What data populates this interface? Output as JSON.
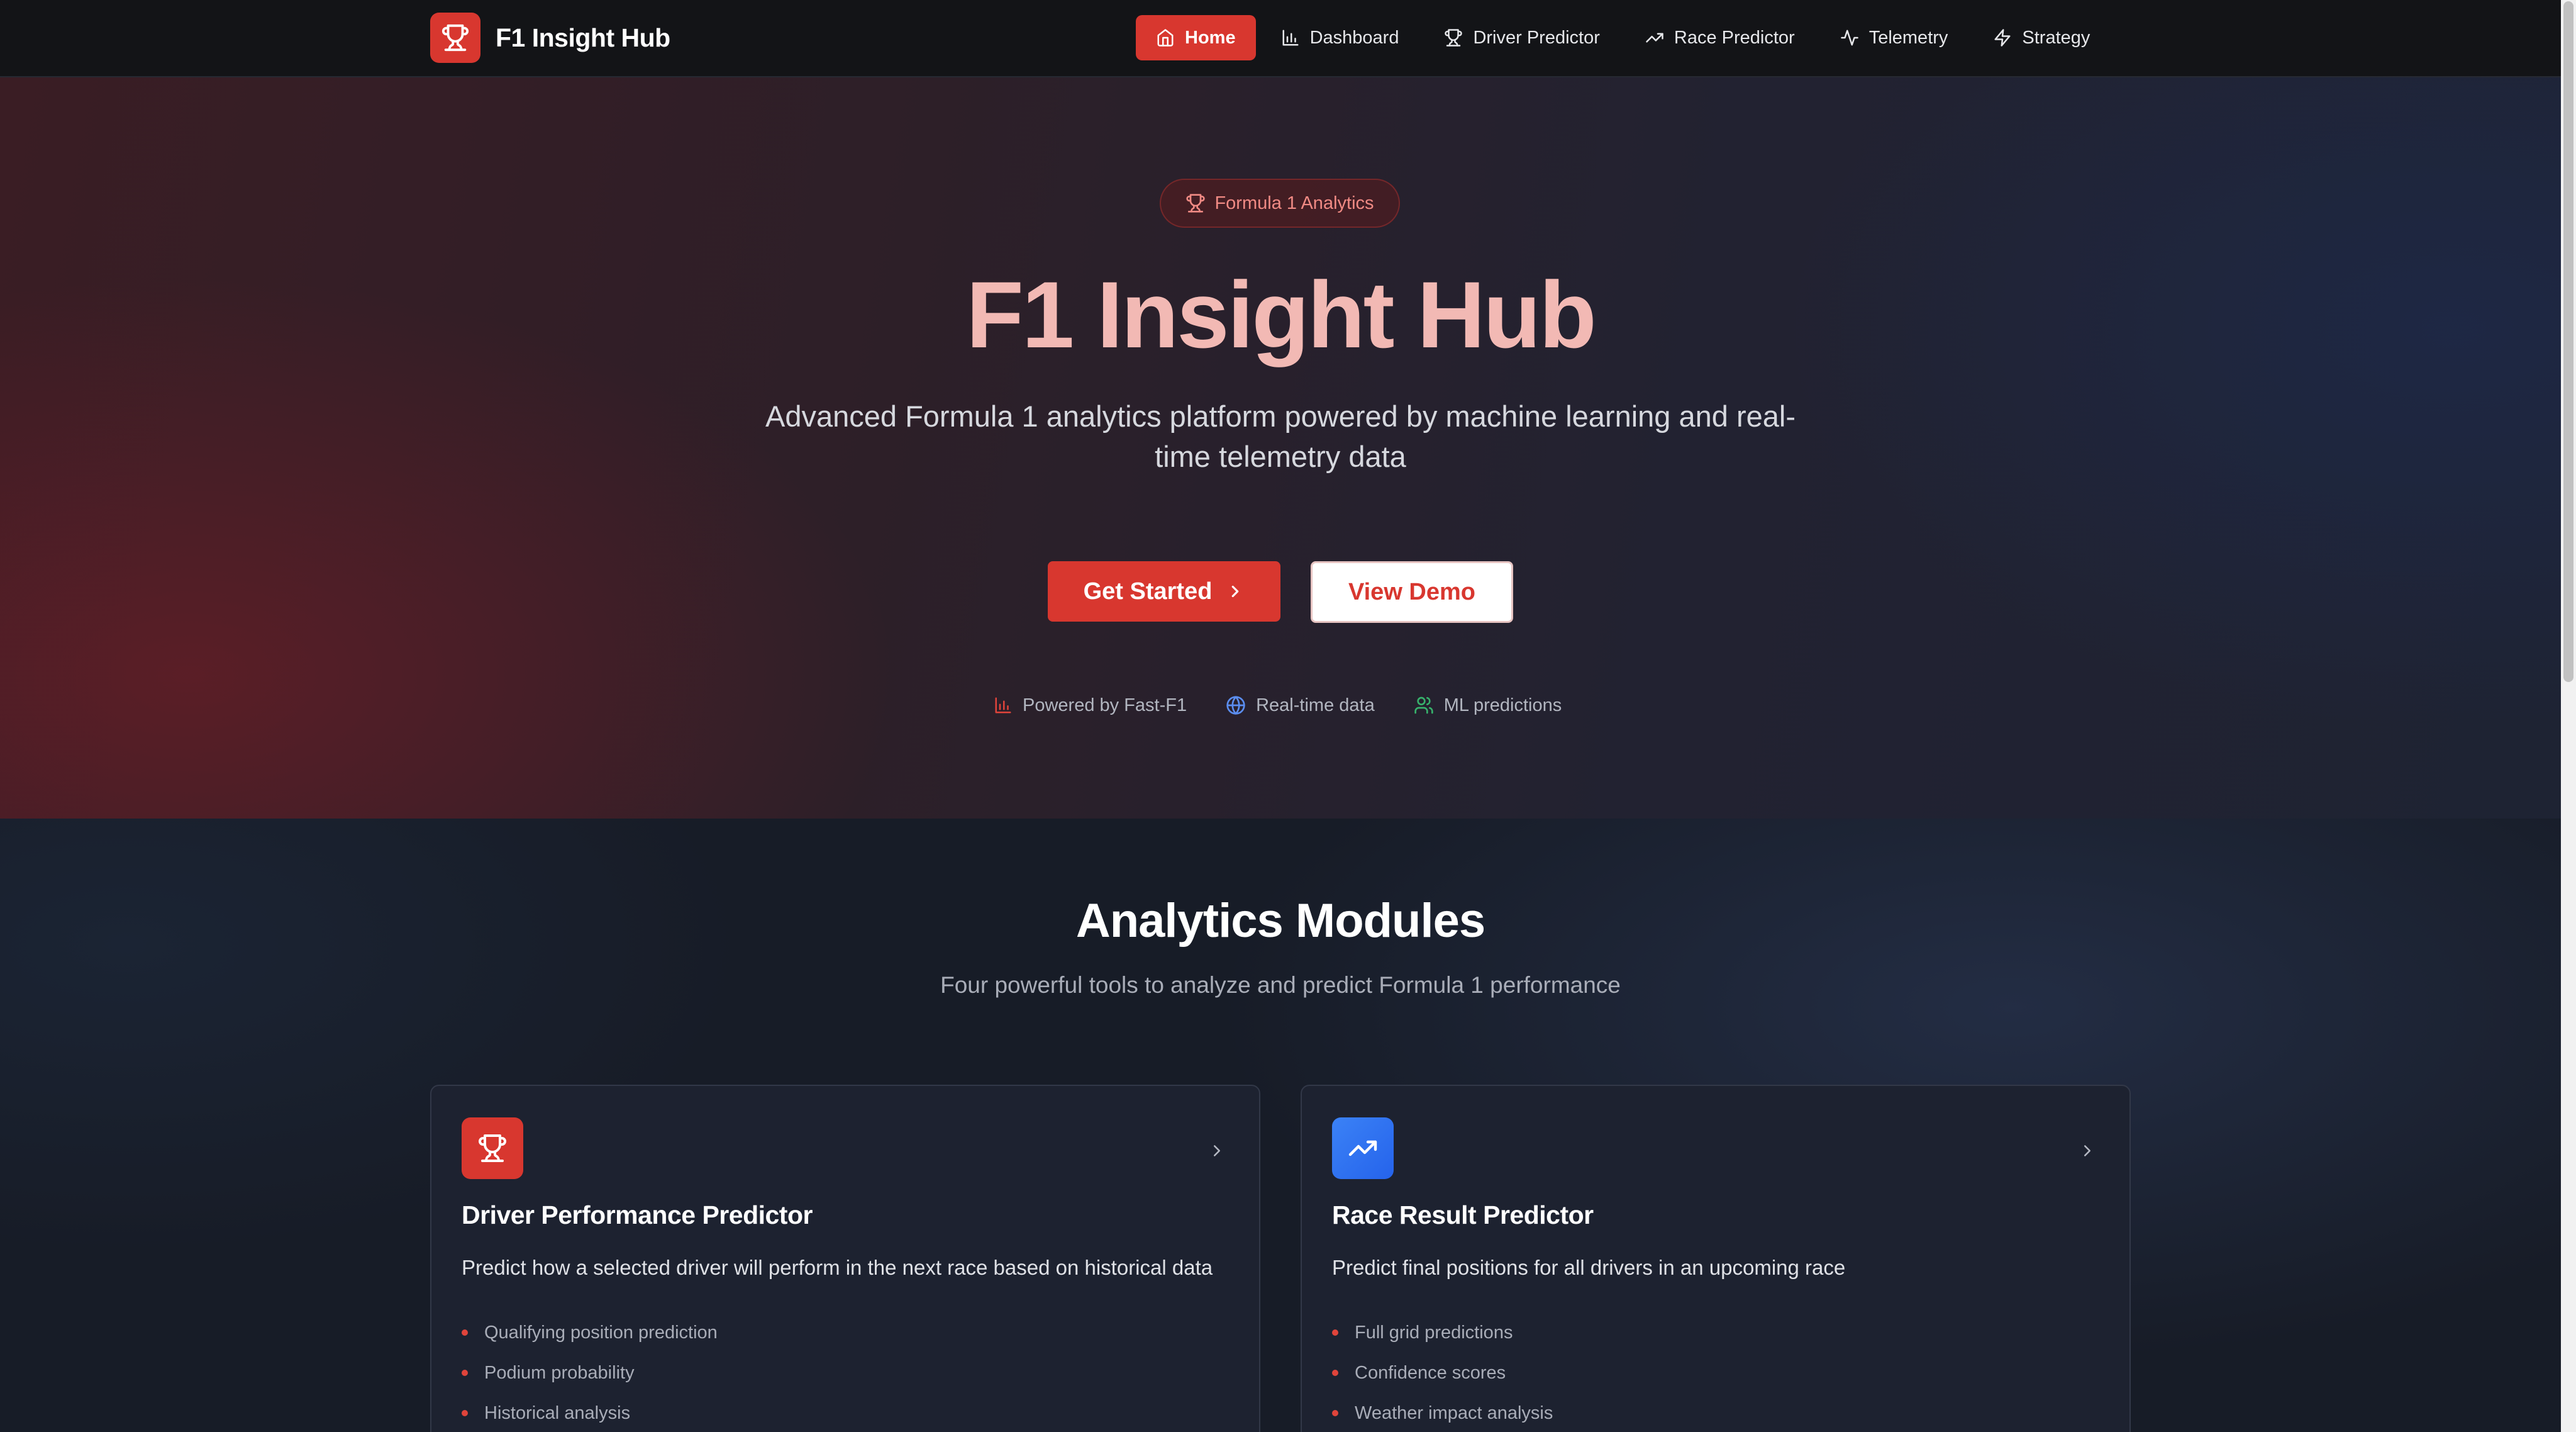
{
  "nav": {
    "brand": "F1 Insight Hub",
    "items": [
      {
        "label": "Home",
        "icon": "home-icon",
        "active": true
      },
      {
        "label": "Dashboard",
        "icon": "bar-chart-icon"
      },
      {
        "label": "Driver Predictor",
        "icon": "trophy-icon"
      },
      {
        "label": "Race Predictor",
        "icon": "trending-up-icon"
      },
      {
        "label": "Telemetry",
        "icon": "activity-icon"
      },
      {
        "label": "Strategy",
        "icon": "zap-icon"
      }
    ]
  },
  "hero": {
    "badge": "Formula 1 Analytics",
    "title": "F1 Insight Hub",
    "subtitle": "Advanced Formula 1 analytics platform powered by machine learning and real-time telemetry data",
    "primary_button": "Get Started",
    "secondary_button": "View Demo",
    "features": [
      {
        "label": "Powered by Fast-F1",
        "icon": "bar-chart-icon"
      },
      {
        "label": "Real-time data",
        "icon": "globe-icon"
      },
      {
        "label": "ML predictions",
        "icon": "users-icon"
      }
    ]
  },
  "modules": {
    "title": "Analytics Modules",
    "subtitle": "Four powerful tools to analyze and predict Formula 1 performance",
    "cards": [
      {
        "title": "Driver Performance Predictor",
        "description": "Predict how a selected driver will perform in the next race based on historical data",
        "icon": "trophy-icon",
        "points": [
          "Qualifying position prediction",
          "Podium probability",
          "Historical analysis"
        ]
      },
      {
        "title": "Race Result Predictor",
        "description": "Predict final positions for all drivers in an upcoming race",
        "icon": "trending-up-icon",
        "points": [
          "Full grid predictions",
          "Confidence scores",
          "Weather impact analysis"
        ]
      }
    ]
  },
  "colors": {
    "accent": "#d8372f",
    "title_pink": "#f2b9b4",
    "blue": "#3b82f6"
  }
}
